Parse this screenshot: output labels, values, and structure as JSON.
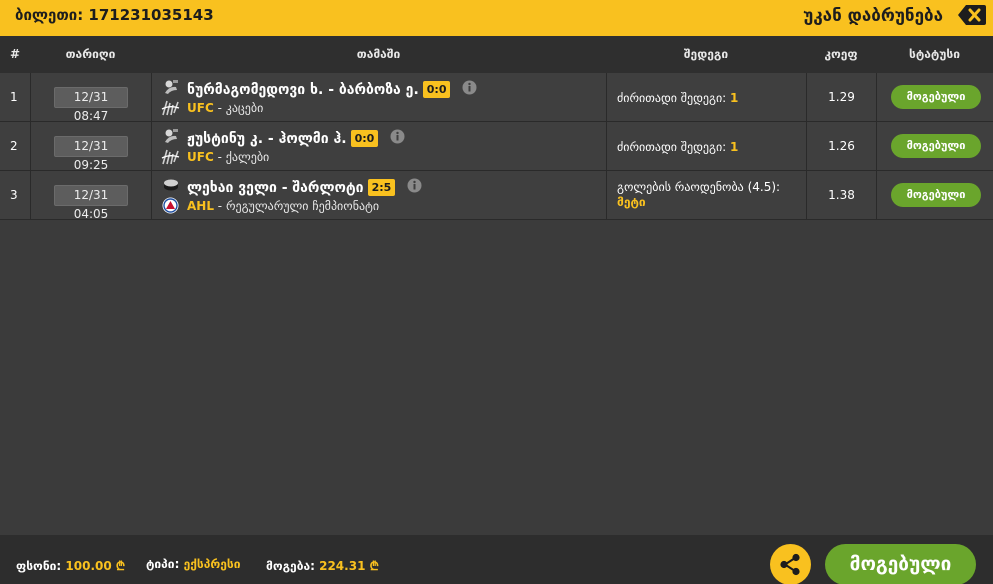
{
  "header": {
    "ticket_label": "ბილეთი: 171231035143",
    "back_label": "უკან დაბრუნება",
    "close_icon": "close-backspace-icon"
  },
  "table": {
    "columns": [
      "#",
      "თარიღი",
      "თამაში",
      "შედეგი",
      "კოეფ",
      "სტატუსი"
    ],
    "rows": [
      {
        "num": "1",
        "date": "12/31 08:47",
        "match": "ნურმაგომედოვი ხ. - ბარბოზა ე.",
        "score": "0:0",
        "sport_icon": "fight-icon",
        "league_icon": "ufc-icon",
        "league": "UFC",
        "category": " - კაცები",
        "result_label": "ძირითადი შედეგი: ",
        "result_value": "1",
        "coef": "1.29",
        "status": "მოგებული"
      },
      {
        "num": "2",
        "date": "12/31 09:25",
        "match": "ჟუსტინუ კ. - ჰოლმი ჰ.",
        "score": "0:0",
        "sport_icon": "fight-icon",
        "league_icon": "ufc-icon",
        "league": "UFC",
        "category": " - ქალები",
        "result_label": "ძირითადი შედეგი: ",
        "result_value": "1",
        "coef": "1.26",
        "status": "მოგებული"
      },
      {
        "num": "3",
        "date": "12/31 04:05",
        "match": "ლეხაი ველი - შარლოტი",
        "score": "2:5",
        "sport_icon": "hockey-puck-icon",
        "league_icon": "ahl-icon",
        "league": "AHL",
        "category": " - რეგულარული ჩემპიონატი",
        "result_label": "გოლების რაოდენობა (4.5):",
        "result_value": "მეტი",
        "coef": "1.38",
        "status": "მოგებული"
      }
    ]
  },
  "footer": {
    "stake_label": "ფსონი:",
    "stake_value": "100.00 ₾",
    "type_label": "ტიპი:",
    "type_value": "ექსპრესი",
    "win_label": "მოგება:",
    "win_value": "224.31 ₾",
    "share_icon": "share-icon",
    "status_button": "მოგებული"
  },
  "colors": {
    "accent": "#f9c11f",
    "win_green": "#6aa52c",
    "background": "#3b3b3b"
  }
}
